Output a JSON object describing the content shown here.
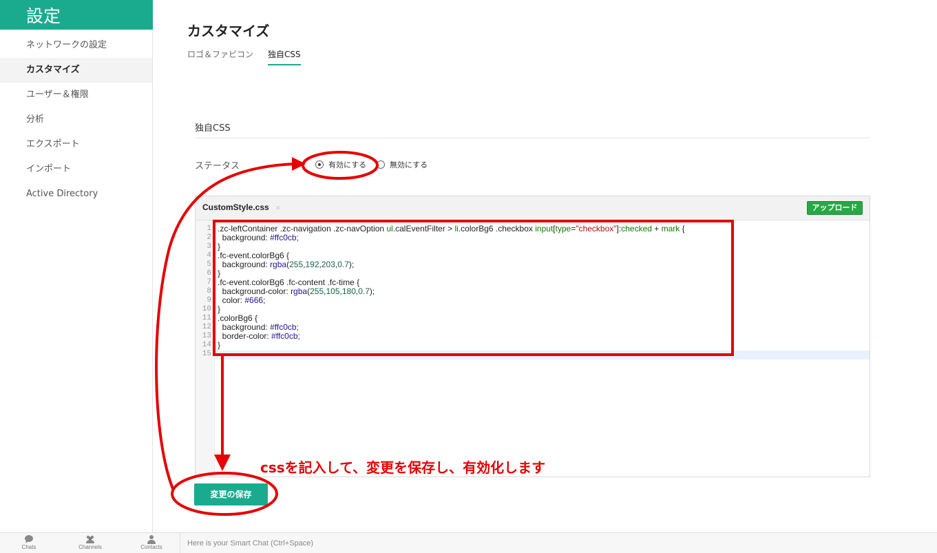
{
  "sidebar": {
    "title": "設定",
    "items": [
      {
        "label": "ネットワークの設定"
      },
      {
        "label": "カスタマイズ"
      },
      {
        "label": "ユーザー＆権限"
      },
      {
        "label": "分析"
      },
      {
        "label": "エクスポート"
      },
      {
        "label": "インポート"
      },
      {
        "label": "Active Directory"
      }
    ],
    "active_index": 1
  },
  "header": {
    "title": "カスタマイズ",
    "tabs": [
      {
        "label": "ロゴ＆ファビコン"
      },
      {
        "label": "独自CSS"
      }
    ],
    "active_tab": 1
  },
  "section": {
    "title": "独自CSS",
    "status_label": "ステータス",
    "options": [
      {
        "label": "有効にする",
        "checked": true
      },
      {
        "label": "無効にする",
        "checked": false
      }
    ]
  },
  "editor": {
    "file_name": "CustomStyle.css",
    "close_glyph": "×",
    "upload_label": "アップロード",
    "line_numbers": [
      "1",
      "2",
      "3",
      "4",
      "5",
      "6",
      "7",
      "8",
      "9",
      "10",
      "11",
      "12",
      "13",
      "14",
      "15"
    ],
    "code_lines": [
      ".zc-leftContainer .zc-navigation .zc-navOption ul.calEventFilter > li.colorBg6 .checkbox input[type=\"checkbox\"]:checked + mark {",
      "  background: #ffc0cb;",
      "}",
      ".fc-event.colorBg6 {",
      "  background: rgba(255,192,203,0.7);",
      "}",
      ".fc-event.colorBg6 .fc-content .fc-time {",
      "  background-color: rgba(255,105,180,0.7);",
      "  color: #666;",
      "}",
      ".colorBg6 {",
      "  background: #ffc0cb;",
      "  border-color: #ffc0cb;",
      "}",
      ""
    ]
  },
  "save_label": "変更の保存",
  "annotation": {
    "text": "cssを記入して、変更を保存し、有効化します",
    "color": "#e60000"
  },
  "bottom_bar": {
    "items": [
      {
        "label": "Chats",
        "icon": "chat-bubble-icon"
      },
      {
        "label": "Channels",
        "icon": "channels-icon"
      },
      {
        "label": "Contacts",
        "icon": "contact-person-icon"
      }
    ],
    "smart_chat_placeholder": "Here is your Smart Chat (Ctrl+Space)"
  },
  "colors": {
    "accent": "#1aab8f",
    "upload": "#28a745",
    "annotation": "#e60000"
  }
}
